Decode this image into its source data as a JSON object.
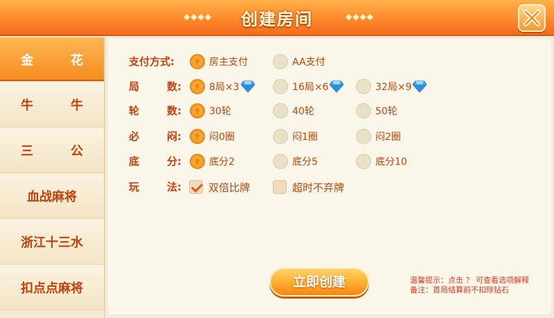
{
  "header": {
    "title": "创建房间",
    "deco_left": "◆◆◆◆",
    "deco_right": "◆◆◆◆"
  },
  "sidebar": {
    "items": [
      {
        "left": "金",
        "right": "花",
        "active": true
      },
      {
        "left": "牛",
        "right": "牛",
        "active": false
      },
      {
        "left": "三",
        "right": "公",
        "active": false
      },
      {
        "label": "血战麻将",
        "active": false
      },
      {
        "label": "浙江十三水",
        "active": false
      },
      {
        "label": "扣点点麻将",
        "active": false
      }
    ]
  },
  "options": {
    "payment": {
      "label": "支付方式:",
      "choices": [
        {
          "text": "房主支付",
          "selected": true
        },
        {
          "text": "AA支付",
          "selected": false
        }
      ]
    },
    "rounds": {
      "label_a": "局",
      "label_b": "数:",
      "choices": [
        {
          "text": "8局×3",
          "selected": true,
          "gem": true
        },
        {
          "text": "16局×6",
          "selected": false,
          "gem": true
        },
        {
          "text": "32局×9",
          "selected": false,
          "gem": true
        }
      ]
    },
    "turns": {
      "label_a": "轮",
      "label_b": "数:",
      "choices": [
        {
          "text": "30轮",
          "selected": true
        },
        {
          "text": "40轮",
          "selected": false
        },
        {
          "text": "50轮",
          "selected": false
        }
      ]
    },
    "must_look": {
      "label_a": "必",
      "label_b": "闷:",
      "choices": [
        {
          "text": "闷0圈",
          "selected": true
        },
        {
          "text": "闷1圈",
          "selected": false
        },
        {
          "text": "闷2圈",
          "selected": false
        }
      ]
    },
    "base_score": {
      "label_a": "底",
      "label_b": "分:",
      "choices": [
        {
          "text": "底分2",
          "selected": true
        },
        {
          "text": "底分5",
          "selected": false
        },
        {
          "text": "底分10",
          "selected": false
        }
      ]
    },
    "play": {
      "label_a": "玩",
      "label_b": "法:",
      "choices": [
        {
          "text": "双倍比牌",
          "checked": true
        },
        {
          "text": "超时不弃牌",
          "checked": false
        }
      ]
    }
  },
  "create_button": {
    "label": "立即创建"
  },
  "tips": {
    "line1": "温馨提示：点击 ？ 可查看选项解释",
    "line2": "备注：首局结算前不扣除钻石"
  },
  "colors": {
    "accent": "#f58a1f",
    "text": "#c2410c",
    "gem": "#3aa6f0"
  },
  "icons": {
    "close": "close-x-icon",
    "radio_on": "spade-radio-icon",
    "gem": "diamond-icon"
  }
}
